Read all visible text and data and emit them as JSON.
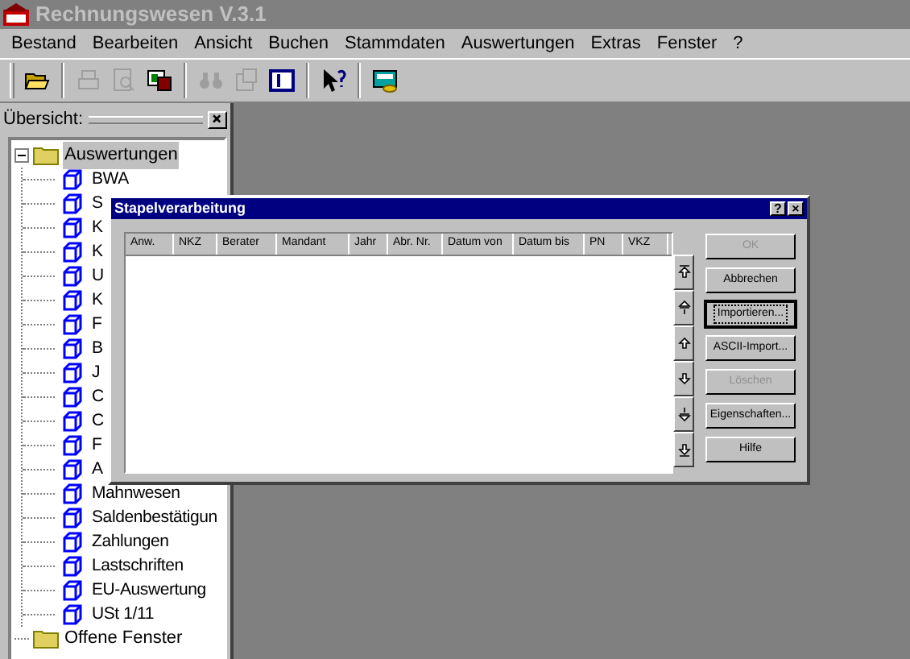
{
  "window": {
    "title": "Rechnungswesen V.3.1"
  },
  "menu": [
    "Bestand",
    "Bearbeiten",
    "Ansicht",
    "Buchen",
    "Stammdaten",
    "Auswertungen",
    "Extras",
    "Fenster",
    "?"
  ],
  "toolbar": [
    {
      "kind": "open",
      "disabled": false
    },
    {
      "kind": "sep"
    },
    {
      "kind": "print",
      "disabled": true
    },
    {
      "kind": "preview",
      "disabled": true
    },
    {
      "kind": "export",
      "disabled": false
    },
    {
      "kind": "sep"
    },
    {
      "kind": "find",
      "disabled": true
    },
    {
      "kind": "props",
      "disabled": true
    },
    {
      "kind": "panel",
      "disabled": false
    },
    {
      "kind": "sep"
    },
    {
      "kind": "help",
      "disabled": false
    },
    {
      "kind": "sep"
    },
    {
      "kind": "calc",
      "disabled": false
    }
  ],
  "overview": {
    "title": "Übersicht:",
    "tree": [
      {
        "label": "Auswertungen",
        "kind": "folder",
        "expanded": true,
        "selected": true,
        "children": [
          {
            "label": "BWA"
          },
          {
            "label": "S"
          },
          {
            "label": "K"
          },
          {
            "label": "K"
          },
          {
            "label": "U"
          },
          {
            "label": "K"
          },
          {
            "label": "F"
          },
          {
            "label": "B"
          },
          {
            "label": "J"
          },
          {
            "label": "C"
          },
          {
            "label": "C"
          },
          {
            "label": "F"
          },
          {
            "label": "A"
          },
          {
            "label": "Mahnwesen"
          },
          {
            "label": "Saldenbestätigun"
          },
          {
            "label": "Zahlungen"
          },
          {
            "label": "Lastschriften"
          },
          {
            "label": "EU-Auswertung"
          },
          {
            "label": "USt 1/11"
          }
        ]
      },
      {
        "label": "Offene Fenster",
        "kind": "folder",
        "selected": false
      }
    ]
  },
  "dialog": {
    "title": "Stapelverarbeitung",
    "title_buttons": [
      "?",
      "×"
    ],
    "columns": [
      "Anw.",
      "NKZ",
      "Berater",
      "Mandant",
      "Jahr",
      "Abr. Nr.",
      "Datum von",
      "Datum bis",
      "PN",
      "VKZ"
    ],
    "move_buttons": [
      {
        "kind": "top"
      },
      {
        "kind": "up_fast"
      },
      {
        "kind": "up"
      },
      {
        "kind": "down"
      },
      {
        "kind": "down_fast"
      },
      {
        "kind": "bottom"
      }
    ],
    "buttons": [
      {
        "label": "OK",
        "disabled": true,
        "focused": false
      },
      {
        "label": "Abbrechen",
        "disabled": false,
        "focused": false
      },
      {
        "label": "Importieren...",
        "disabled": false,
        "focused": true
      },
      {
        "label": "ASCII-Import...",
        "disabled": false,
        "focused": false
      },
      {
        "label": "Löschen",
        "disabled": true,
        "focused": false
      },
      {
        "label": "Eigenschaften...",
        "disabled": false,
        "focused": false
      },
      {
        "label": "Hilfe",
        "disabled": false,
        "focused": false
      }
    ]
  }
}
